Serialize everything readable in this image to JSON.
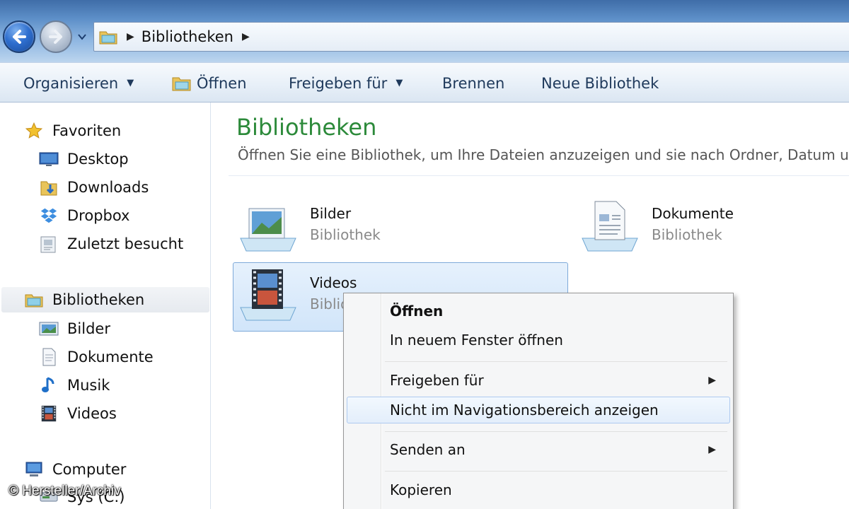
{
  "address": {
    "crumbs": [
      "Bibliotheken"
    ]
  },
  "toolbar": {
    "organize": "Organisieren",
    "open": "Öffnen",
    "share": "Freigeben für",
    "burn": "Brennen",
    "new_library": "Neue Bibliothek"
  },
  "sidebar": {
    "favorites": {
      "label": "Favoriten",
      "items": [
        {
          "label": "Desktop",
          "icon": "desktop-icon"
        },
        {
          "label": "Downloads",
          "icon": "downloads-icon"
        },
        {
          "label": "Dropbox",
          "icon": "dropbox-icon"
        },
        {
          "label": "Zuletzt besucht",
          "icon": "recent-places-icon"
        }
      ]
    },
    "libraries": {
      "label": "Bibliotheken",
      "items": [
        {
          "label": "Bilder",
          "icon": "pictures-icon"
        },
        {
          "label": "Dokumente",
          "icon": "documents-icon"
        },
        {
          "label": "Musik",
          "icon": "music-icon"
        },
        {
          "label": "Videos",
          "icon": "videos-icon"
        }
      ]
    },
    "computer": {
      "label": "Computer",
      "next_label": "Sys (C:)"
    }
  },
  "content": {
    "title": "Bibliotheken",
    "description": "Öffnen Sie eine Bibliothek, um Ihre Dateien anzuzeigen und sie nach Ordner, Datum und",
    "libraries": [
      {
        "name": "Bilder",
        "type": "Bibliothek",
        "icon": "pictures-library-icon"
      },
      {
        "name": "Dokumente",
        "type": "Bibliothek",
        "icon": "documents-library-icon"
      },
      {
        "name": "Videos",
        "type": "Bibliothek",
        "icon": "videos-library-icon",
        "selected": true
      }
    ]
  },
  "context_menu": {
    "items": [
      {
        "label": "Öffnen",
        "bold": true
      },
      {
        "label": "In neuem Fenster öffnen"
      },
      {
        "label": "Freigeben für",
        "submenu": true
      },
      {
        "label": "Nicht im Navigationsbereich anzeigen",
        "hover": true
      },
      {
        "label": "Senden an",
        "submenu": true
      },
      {
        "label": "Kopieren"
      }
    ]
  },
  "watermark": "© Hersteller/Archiv",
  "colors": {
    "title_green": "#2c8a3a",
    "selection_blue": "#d1e5fa",
    "toolbar_text": "#1e395b"
  }
}
